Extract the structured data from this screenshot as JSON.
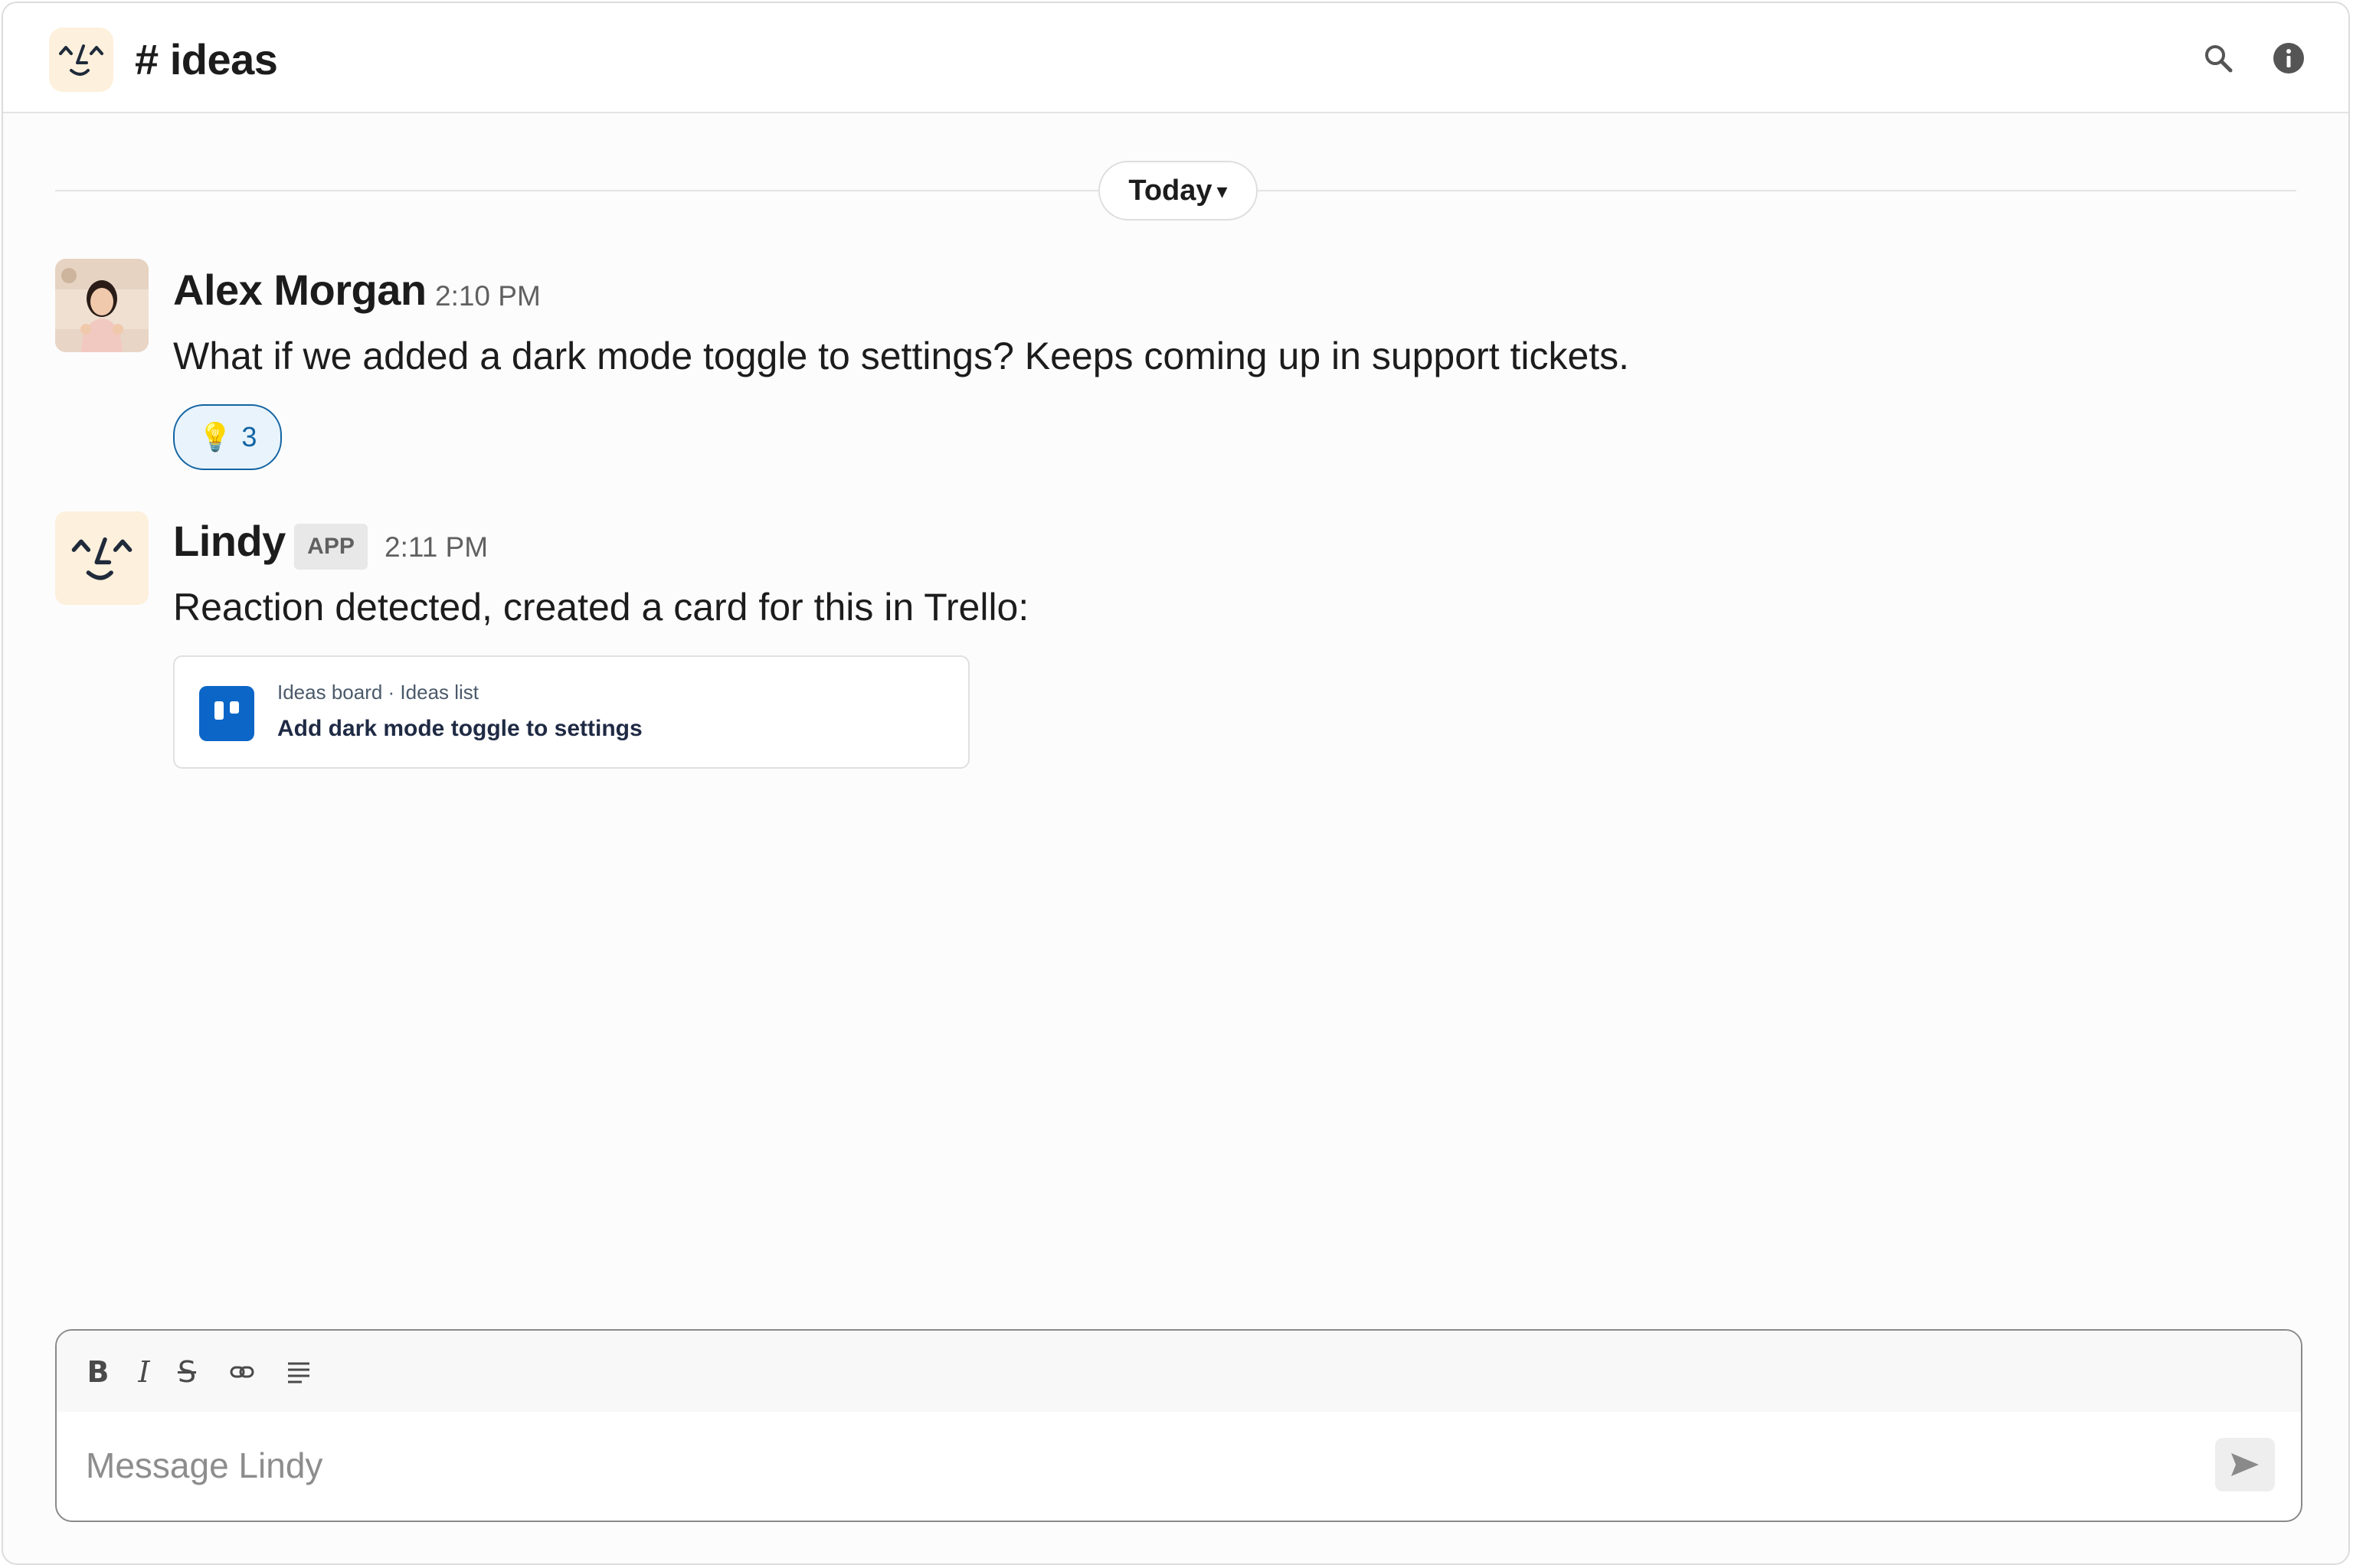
{
  "header": {
    "channel_title": "# ideas",
    "logo_icon": "lindy-face-icon",
    "search_icon": "search-icon",
    "info_icon": "info-icon"
  },
  "divider": {
    "label": "Today",
    "caret": "▾"
  },
  "messages": [
    {
      "author": "Alex Morgan",
      "time": "2:10 PM",
      "text": "What if we added a dark mode toggle to settings? Keeps coming up in support tickets.",
      "avatar": "user-photo-avatar",
      "reactions": [
        {
          "emoji": "💡",
          "count": "3"
        }
      ]
    },
    {
      "author": "Lindy",
      "badge": "APP",
      "time": "2:11 PM",
      "text": "Reaction detected, created a card for this in Trello:",
      "avatar": "lindy-face-icon",
      "card": {
        "meta": "Ideas board · Ideas list",
        "title": "Add dark mode toggle to settings",
        "icon": "trello-icon"
      }
    }
  ],
  "composer": {
    "tools": [
      "B",
      "I",
      "S"
    ],
    "placeholder": "Message Lindy",
    "value": "",
    "send_icon": "send-icon"
  },
  "colors": {
    "accent": "#1264a3",
    "trello": "#0c66c7",
    "logo_bg": "#fdf0dc"
  }
}
